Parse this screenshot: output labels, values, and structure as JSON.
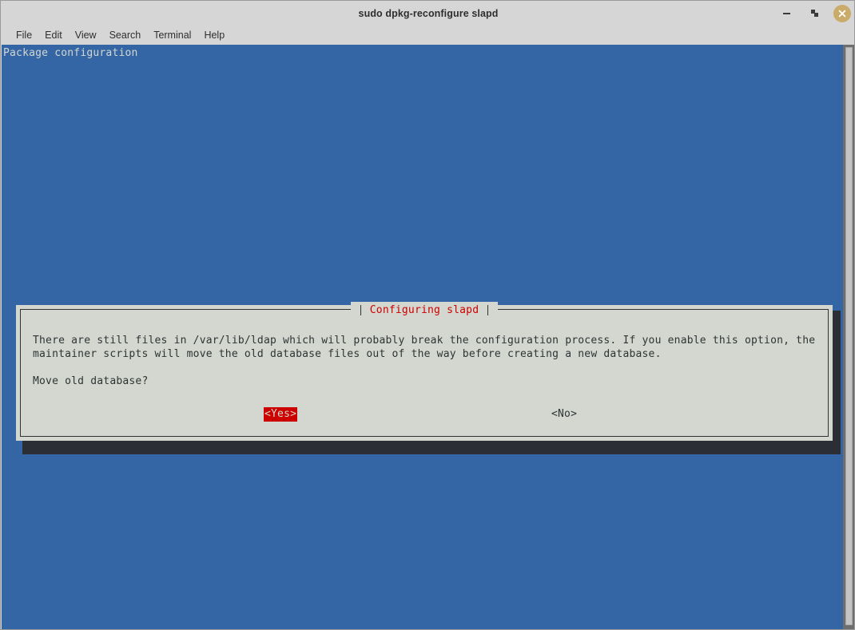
{
  "window": {
    "title": "sudo dpkg-reconfigure slapd",
    "controls": {
      "minimize_label": "minimize",
      "maximize_label": "restore",
      "close_label": "close",
      "close_color": "#c9ab6a"
    }
  },
  "menubar": {
    "items": [
      {
        "label": "File"
      },
      {
        "label": "Edit"
      },
      {
        "label": "View"
      },
      {
        "label": "Search"
      },
      {
        "label": "Terminal"
      },
      {
        "label": "Help"
      }
    ]
  },
  "terminal": {
    "background_color": "#3465a4",
    "foreground_color": "#d3d7cf",
    "header_text": "Package configuration"
  },
  "scrollbar": {
    "track_color": "#6e6e6e",
    "thumb_color": "#c4c4c4"
  },
  "dialog": {
    "title": "Configuring slapd",
    "title_color": "#cc0000",
    "background_color": "#d3d7cf",
    "border_color": "#2e3436",
    "paragraph": "There are still files in /var/lib/ldap which will probably break the configuration process. If you enable this option, the\nmaintainer scripts will move the old database files out of the way before creating a new database.",
    "question": "Move old database?",
    "buttons": {
      "yes": {
        "label": "<Yes>",
        "selected": true,
        "selected_bg": "#cc0000",
        "selected_fg": "#d3d7cf"
      },
      "no": {
        "label": "<No>",
        "selected": false
      }
    }
  }
}
